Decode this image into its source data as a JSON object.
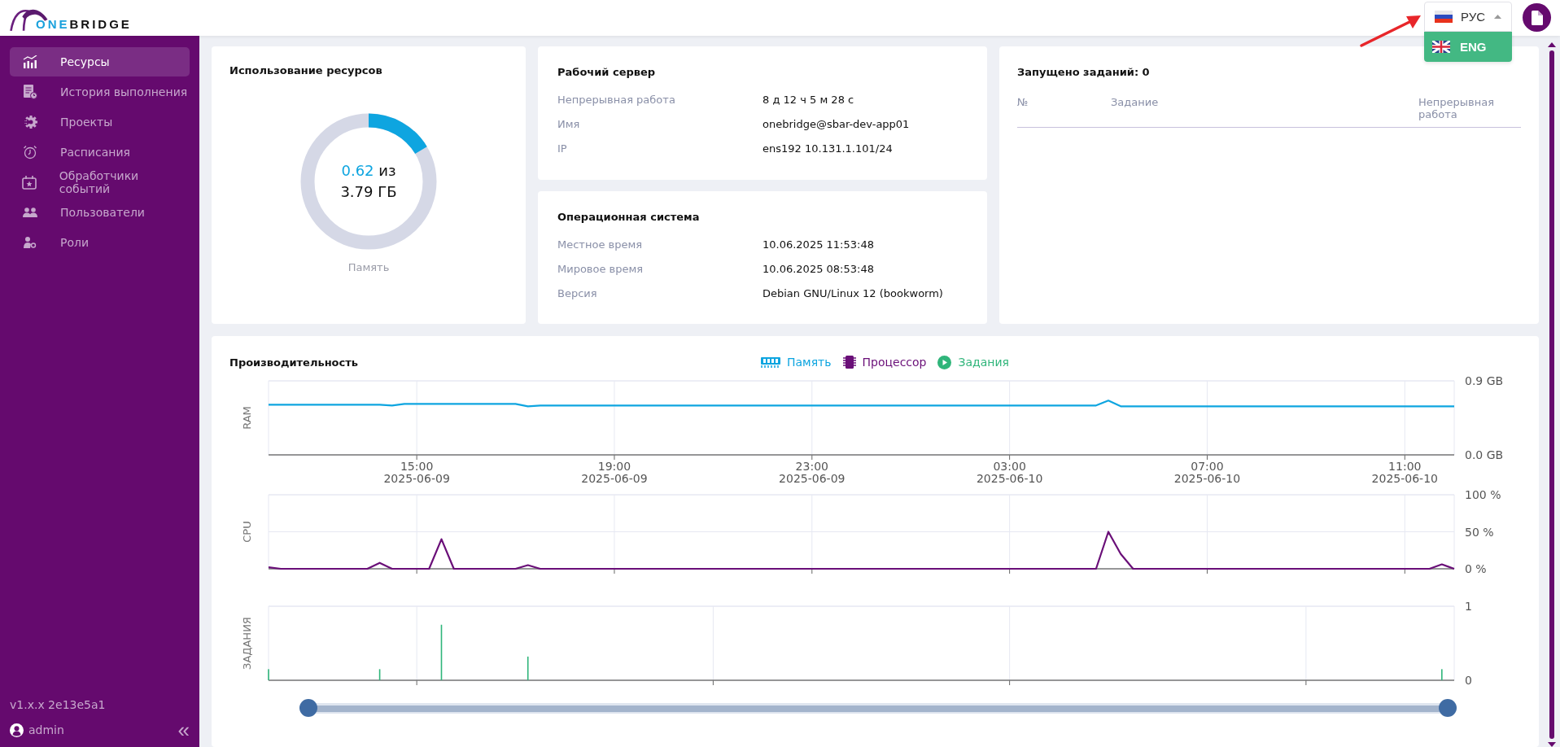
{
  "header": {
    "logo_accent": "ONE",
    "logo_rest": "BRIDGE",
    "language": {
      "current": "РУС",
      "expanded": true,
      "options": [
        {
          "label": "ENG",
          "highlighted": true
        }
      ]
    },
    "annotation_arrow": true
  },
  "sidebar": {
    "items": [
      {
        "label": "Ресурсы",
        "kind": "resources",
        "selected": true
      },
      {
        "label": "История выполнения",
        "kind": "history",
        "selected": false
      },
      {
        "label": "Проекты",
        "kind": "projects",
        "selected": false
      },
      {
        "label": "Расписания",
        "kind": "schedules",
        "selected": false
      },
      {
        "label": "Обработчики событий",
        "kind": "events",
        "selected": false
      },
      {
        "label": "Пользователи",
        "kind": "users",
        "selected": false
      },
      {
        "label": "Роли",
        "kind": "roles",
        "selected": false
      }
    ],
    "version": "v1.x.x 2e13e5a1",
    "user": "admin",
    "collapse": "«"
  },
  "resources": {
    "title": "Использование ресурсов",
    "used": "0.62",
    "of": "из",
    "total": "3.79 ГБ",
    "level": 0.164,
    "caption": "Память"
  },
  "server": {
    "title": "Рабочий сервер",
    "rows": [
      {
        "label": "Непрерывная работа",
        "value": "8 д 12 ч 5 м 28 с"
      },
      {
        "label": "Имя",
        "value": "onebridge@sbar-dev-app01"
      },
      {
        "label": "IP",
        "value": "ens192 10.131.1.101/24"
      }
    ]
  },
  "os": {
    "title": "Операционная система",
    "rows": [
      {
        "label": "Местное время",
        "value": "10.06.2025 11:53:48"
      },
      {
        "label": "Мировое время",
        "value": "10.06.2025 08:53:48"
      },
      {
        "label": "Версия",
        "value": "Debian GNU/Linux 12 (bookworm)"
      }
    ]
  },
  "jobs": {
    "title": "Запущено заданий: 0",
    "columns": [
      "№",
      "Задание",
      "Непрерывная работа"
    ]
  },
  "performance": {
    "title": "Производительность",
    "charts": [
      {
        "chart_data": {
          "type": "line",
          "ylabel": "RAM",
          "categories": [
            null,
            null,
            null,
            null,
            null,
            null,
            null,
            null,
            null,
            null,
            null,
            null,
            "15:00 2025-06-09",
            null,
            null,
            null,
            null,
            null,
            null,
            null,
            null,
            null,
            null,
            null,
            null,
            null,
            null,
            null,
            "19:00 2025-06-09",
            null,
            null,
            null,
            null,
            null,
            null,
            null,
            null,
            null,
            null,
            null,
            null,
            null,
            null,
            null,
            "23:00 2025-06-09",
            null,
            null,
            null,
            null,
            null,
            null,
            null,
            null,
            null,
            null,
            null,
            null,
            null,
            null,
            null,
            "03:00 2025-06-10",
            null,
            null,
            null,
            null,
            null,
            null,
            null,
            null,
            null,
            null,
            null,
            null,
            null,
            null,
            null,
            "07:00 2025-06-10",
            null,
            null,
            null,
            null,
            null,
            null,
            null,
            null,
            null,
            null,
            null,
            null,
            null,
            null,
            null,
            "11:00 2025-06-10",
            null,
            null,
            null,
            null
          ],
          "series": [
            {
              "name": "Память",
              "color": "#0ea5e0",
              "values": [
                0.61,
                0.61,
                0.61,
                0.61,
                0.61,
                0.61,
                0.61,
                0.61,
                0.61,
                0.61,
                0.6,
                0.62,
                0.62,
                0.62,
                0.62,
                0.62,
                0.62,
                0.62,
                0.62,
                0.62,
                0.62,
                0.59,
                0.6,
                0.6,
                0.6,
                0.6,
                0.6,
                0.6,
                0.6,
                0.6,
                0.6,
                0.6,
                0.6,
                0.6,
                0.6,
                0.6,
                0.6,
                0.6,
                0.6,
                0.6,
                0.6,
                0.6,
                0.6,
                0.6,
                0.6,
                0.6,
                0.6,
                0.6,
                0.6,
                0.6,
                0.6,
                0.6,
                0.6,
                0.6,
                0.6,
                0.6,
                0.6,
                0.6,
                0.6,
                0.6,
                0.6,
                0.6,
                0.6,
                0.6,
                0.6,
                0.6,
                0.6,
                0.6,
                0.66,
                0.59,
                0.59,
                0.59,
                0.59,
                0.59,
                0.59,
                0.59,
                0.59,
                0.59,
                0.59,
                0.59,
                0.59,
                0.59,
                0.59,
                0.59,
                0.59,
                0.59,
                0.59,
                0.59,
                0.59,
                0.59,
                0.59,
                0.59,
                0.59,
                0.59,
                0.59,
                0.59,
                0.59
              ]
            }
          ],
          "grid": true,
          "ylim": [
            0,
            0.9
          ],
          "yticks": [
            {
              "value": 0,
              "label": "0.0 GB"
            },
            {
              "value": 0.9,
              "label": "0.9 GB"
            }
          ]
        }
      },
      {
        "chart_data": {
          "type": "line",
          "ylabel": "CPU",
          "categories": [
            null,
            null,
            null,
            null,
            null,
            null,
            null,
            null,
            null,
            null,
            null,
            null,
            null,
            null,
            null,
            null,
            null,
            null,
            null,
            null,
            null,
            null,
            null,
            null,
            null,
            null,
            null,
            null,
            null,
            null,
            null,
            null,
            null,
            null,
            null,
            null,
            null,
            null,
            null,
            null,
            null,
            null,
            null,
            null,
            null,
            null,
            null,
            null,
            null,
            null,
            null,
            null,
            null,
            null,
            null,
            null,
            null,
            null,
            null,
            null,
            null,
            null,
            null,
            null,
            null,
            null,
            null,
            null,
            null,
            null,
            null,
            null,
            null,
            null,
            null,
            null,
            null,
            null,
            null,
            null,
            null,
            null,
            null,
            null,
            null,
            null,
            null,
            null,
            null,
            null,
            null,
            null,
            null,
            null,
            null,
            null,
            null
          ],
          "series": [
            {
              "name": "Процессор",
              "color": "#6a0f78",
              "values": [
                2,
                0,
                0,
                0,
                0,
                0,
                0,
                0,
                0,
                8,
                0,
                0,
                0,
                0,
                40,
                0,
                0,
                0,
                0,
                0,
                0,
                5,
                0,
                0,
                0,
                0,
                0,
                0,
                0,
                0,
                0,
                0,
                0,
                0,
                0,
                0,
                0,
                0,
                0,
                0,
                0,
                0,
                0,
                0,
                0,
                0,
                0,
                0,
                0,
                0,
                0,
                0,
                0,
                0,
                0,
                0,
                0,
                0,
                0,
                0,
                0,
                0,
                0,
                0,
                0,
                0,
                0,
                0,
                50,
                20,
                0,
                0,
                0,
                0,
                0,
                0,
                0,
                0,
                0,
                0,
                0,
                0,
                0,
                0,
                0,
                0,
                0,
                0,
                0,
                0,
                0,
                0,
                0,
                0,
                0,
                6,
                0
              ]
            }
          ],
          "grid": true,
          "ylim": [
            0,
            100
          ],
          "yticks": [
            {
              "value": 0,
              "label": "0 %"
            },
            {
              "value": 50,
              "label": "50 %"
            },
            {
              "value": 100,
              "label": "100 %"
            }
          ]
        }
      },
      {
        "chart_data": {
          "type": "bar",
          "ylabel": "ЗАДАНИЯ",
          "categories": [
            null,
            null,
            null,
            null,
            null,
            null,
            null,
            null,
            null,
            null,
            null,
            null,
            null,
            null,
            null,
            null,
            null,
            null,
            null,
            null,
            null,
            null,
            null,
            null,
            null,
            null,
            null,
            null,
            null,
            null,
            null,
            null,
            null,
            null,
            null,
            null,
            null,
            null,
            null,
            null,
            null,
            null,
            null,
            null,
            null,
            null,
            null,
            null,
            null,
            null,
            null,
            null,
            null,
            null,
            null,
            null,
            null,
            null,
            null,
            null,
            null,
            null,
            null,
            null,
            null,
            null,
            null,
            null,
            null,
            null,
            null,
            null,
            null,
            null,
            null,
            null,
            null,
            null,
            null,
            null,
            null,
            null,
            null,
            null,
            null,
            null,
            null,
            null,
            null,
            null,
            null,
            null,
            null,
            null,
            null,
            null,
            null
          ],
          "series": [
            {
              "name": "Задания",
              "color": "#2fb57a",
              "values": [
                0.15,
                0,
                0,
                0,
                0,
                0,
                0,
                0,
                0,
                0.15,
                0,
                0,
                0,
                0,
                0.75,
                0,
                0,
                0,
                0,
                0,
                0,
                0.32,
                0,
                0,
                0,
                0,
                0,
                0,
                0,
                0,
                0,
                0,
                0,
                0,
                0,
                0,
                0,
                0,
                0,
                0,
                0,
                0,
                0,
                0,
                0,
                0,
                0,
                0,
                0,
                0,
                0,
                0,
                0,
                0,
                0,
                0,
                0,
                0,
                0,
                0,
                0,
                0,
                0,
                0,
                0,
                0,
                0,
                0,
                0,
                0,
                0,
                0,
                0,
                0,
                0,
                0,
                0,
                0,
                0,
                0,
                0,
                0,
                0,
                0,
                0,
                0,
                0,
                0,
                0,
                0,
                0,
                0,
                0,
                0,
                0,
                0.15,
                0
              ]
            }
          ],
          "grid": true,
          "ylim": [
            0,
            1
          ],
          "yticks": [
            0,
            1
          ]
        }
      }
    ],
    "zoom_slider": {
      "level": 1
    }
  }
}
